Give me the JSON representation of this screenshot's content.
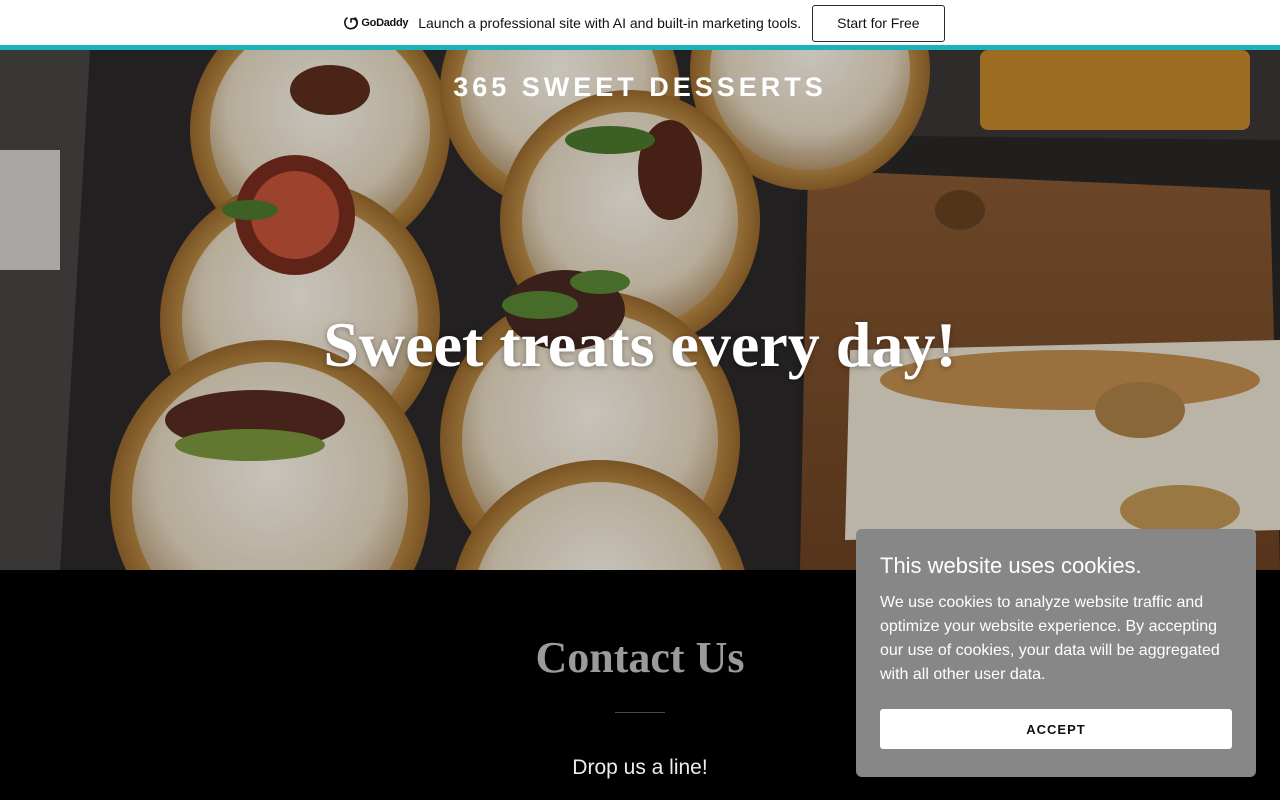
{
  "promo": {
    "brand": "GoDaddy",
    "message": "Launch a professional site with AI and built-in marketing tools.",
    "cta_label": "Start for Free"
  },
  "hero": {
    "site_title": "365 SWEET DESSERTS",
    "tagline": "Sweet treats every day!"
  },
  "contact": {
    "heading": "Contact Us",
    "subheading": "Drop us a line!"
  },
  "cookie_banner": {
    "title": "This website uses cookies.",
    "body": "We use cookies to analyze website traffic and optimize your website experience. By accepting our use of cookies, your data will be aggregated with all other user data.",
    "accept_label": "ACCEPT"
  },
  "colors": {
    "accent_bar": "#1bb3b8",
    "cookie_bg": "#878787",
    "contact_heading": "#9a9a9a"
  }
}
